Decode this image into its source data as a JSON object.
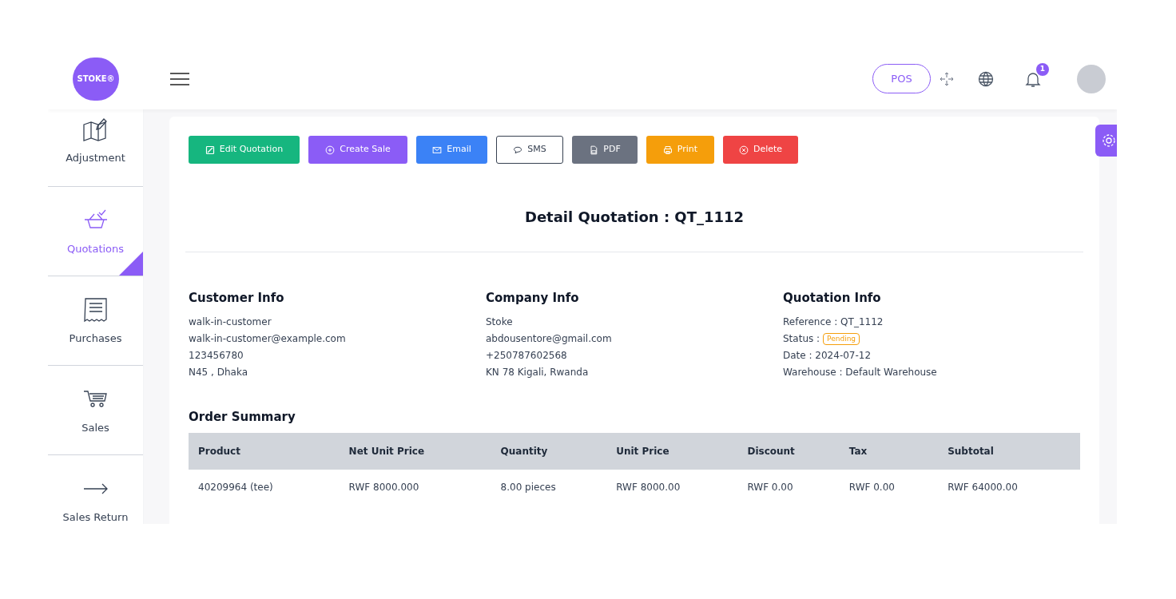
{
  "header": {
    "logo": "STOKE®",
    "pos_button": "POS",
    "notification_count": "1"
  },
  "sidebar": {
    "items": [
      {
        "label": "Adjustment",
        "selected": false
      },
      {
        "label": "Quotations",
        "selected": true
      },
      {
        "label": "Purchases",
        "selected": false
      },
      {
        "label": "Sales",
        "selected": false
      },
      {
        "label": "Sales Return",
        "selected": false
      }
    ]
  },
  "actions": [
    {
      "label": "Edit Quotation",
      "kind": "solid",
      "color": "#16b67f"
    },
    {
      "label": "Create Sale",
      "kind": "solid",
      "color": "#8b5cf6"
    },
    {
      "label": "Email",
      "kind": "solid",
      "color": "#3b82f6"
    },
    {
      "label": "SMS",
      "kind": "outline",
      "color": "#374151"
    },
    {
      "label": "PDF",
      "kind": "solid",
      "color": "#6b7280"
    },
    {
      "label": "Print",
      "kind": "solid",
      "color": "#f59e0b"
    },
    {
      "label": "Delete",
      "kind": "solid",
      "color": "#ef4444"
    }
  ],
  "title": "Detail Quotation : QT_1112",
  "info_sections": [
    {
      "heading": "Customer Info",
      "lines": [
        {
          "kind": "text",
          "text": "walk-in-customer"
        },
        {
          "kind": "text",
          "text": "walk-in-customer@example.com"
        },
        {
          "kind": "text",
          "text": "123456780"
        },
        {
          "kind": "text",
          "text": "N45 , Dhaka"
        }
      ]
    },
    {
      "heading": "Company Info",
      "lines": [
        {
          "kind": "text",
          "text": "Stoke"
        },
        {
          "kind": "text",
          "text": "abdousentore@gmail.com"
        },
        {
          "kind": "text",
          "text": "+250787602568"
        },
        {
          "kind": "text",
          "text": "KN 78 Kigali, Rwanda"
        }
      ]
    },
    {
      "heading": "Quotation Info",
      "lines": [
        {
          "kind": "text",
          "text": "Reference : QT_1112"
        },
        {
          "kind": "badge",
          "text": "Status :",
          "badge": "Pending",
          "color": "#f59e0b"
        },
        {
          "kind": "text",
          "text": "Date : 2024-07-12"
        },
        {
          "kind": "text",
          "text": "Warehouse : Default Warehouse"
        }
      ]
    }
  ],
  "order_summary": {
    "heading": "Order Summary",
    "columns": [
      "Product",
      "Net Unit Price",
      "Quantity",
      "Unit Price",
      "Discount",
      "Tax",
      "Subtotal"
    ],
    "rows": [
      [
        "40209964 (tee)",
        "RWF 8000.000",
        "8.00 pieces",
        "RWF 8000.00",
        "RWF 0.00",
        "RWF 0.00",
        "RWF 64000.00"
      ]
    ]
  }
}
